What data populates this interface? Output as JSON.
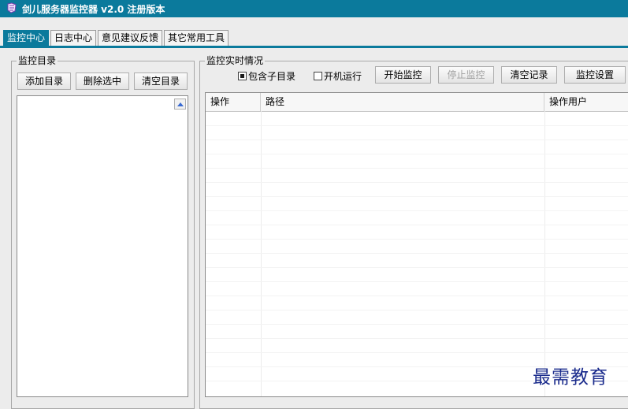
{
  "window": {
    "title": "剑儿服务器监控器 v2.0 注册版本"
  },
  "tabs": [
    "监控中心",
    "日志中心",
    "意见建议反馈",
    "其它常用工具"
  ],
  "dir_group": {
    "legend": "监控目录",
    "add_label": "添加目录",
    "delete_label": "删除选中",
    "clear_label": "清空目录"
  },
  "monitor_group": {
    "legend": "监控实时情况",
    "include_subdirs": {
      "label": "包含子目录",
      "checked": true
    },
    "autostart": {
      "label": "开机运行",
      "checked": false
    },
    "start_label": "开始监控",
    "stop_label": "停止监控",
    "clear_records_label": "清空记录",
    "settings_label": "监控设置"
  },
  "table": {
    "columns": [
      "操作",
      "路径",
      "操作用户"
    ],
    "rows": []
  },
  "watermark": "最需教育",
  "colors": {
    "accent": "#0b7a9c",
    "watermark": "#1a2b8c"
  }
}
